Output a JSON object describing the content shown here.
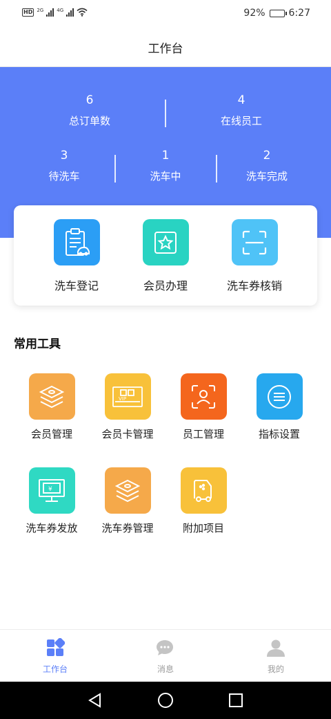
{
  "status_bar": {
    "left_tags": [
      "HD",
      "2G",
      "4G"
    ],
    "battery": "92%",
    "time": "6:27"
  },
  "header": {
    "title": "工作台"
  },
  "stats": {
    "total_orders": {
      "value": "6",
      "label": "总订单数"
    },
    "online_staff": {
      "value": "4",
      "label": "在线员工"
    },
    "waiting": {
      "value": "3",
      "label": "待洗车"
    },
    "washing": {
      "value": "1",
      "label": "洗车中"
    },
    "done": {
      "value": "2",
      "label": "洗车完成"
    }
  },
  "quick_actions": [
    {
      "label": "洗车登记",
      "icon": "clipboard-car-icon",
      "color": "#2b9ef5"
    },
    {
      "label": "会员办理",
      "icon": "star-badge-icon",
      "color": "#29d3c2"
    },
    {
      "label": "洗车券核销",
      "icon": "scan-icon",
      "color": "#4fc3f7"
    }
  ],
  "tools": {
    "title": "常用工具",
    "items": [
      {
        "label": "会员管理",
        "icon": "layers-icon",
        "color": "#f5a94a"
      },
      {
        "label": "会员卡管理",
        "icon": "vip-card-icon",
        "color": "#f8c13a"
      },
      {
        "label": "员工管理",
        "icon": "person-frame-icon",
        "color": "#f4661d"
      },
      {
        "label": "指标设置",
        "icon": "list-circle-icon",
        "color": "#27a8ee"
      },
      {
        "label": "洗车券发放",
        "icon": "ticket-monitor-icon",
        "color": "#2fd9c3"
      },
      {
        "label": "洗车券管理",
        "icon": "layers-icon",
        "color": "#f5a94a"
      },
      {
        "label": "附加项目",
        "icon": "truck-icon",
        "color": "#f8c13a"
      }
    ]
  },
  "tabbar": [
    {
      "label": "工作台",
      "icon": "grid-icon",
      "active": true
    },
    {
      "label": "消息",
      "icon": "chat-icon",
      "active": false
    },
    {
      "label": "我的",
      "icon": "user-icon",
      "active": false
    }
  ],
  "colors": {
    "accent": "#5b7ff8",
    "tab_active": "#5b7ff8",
    "tab_inactive": "#9a9a9a"
  }
}
